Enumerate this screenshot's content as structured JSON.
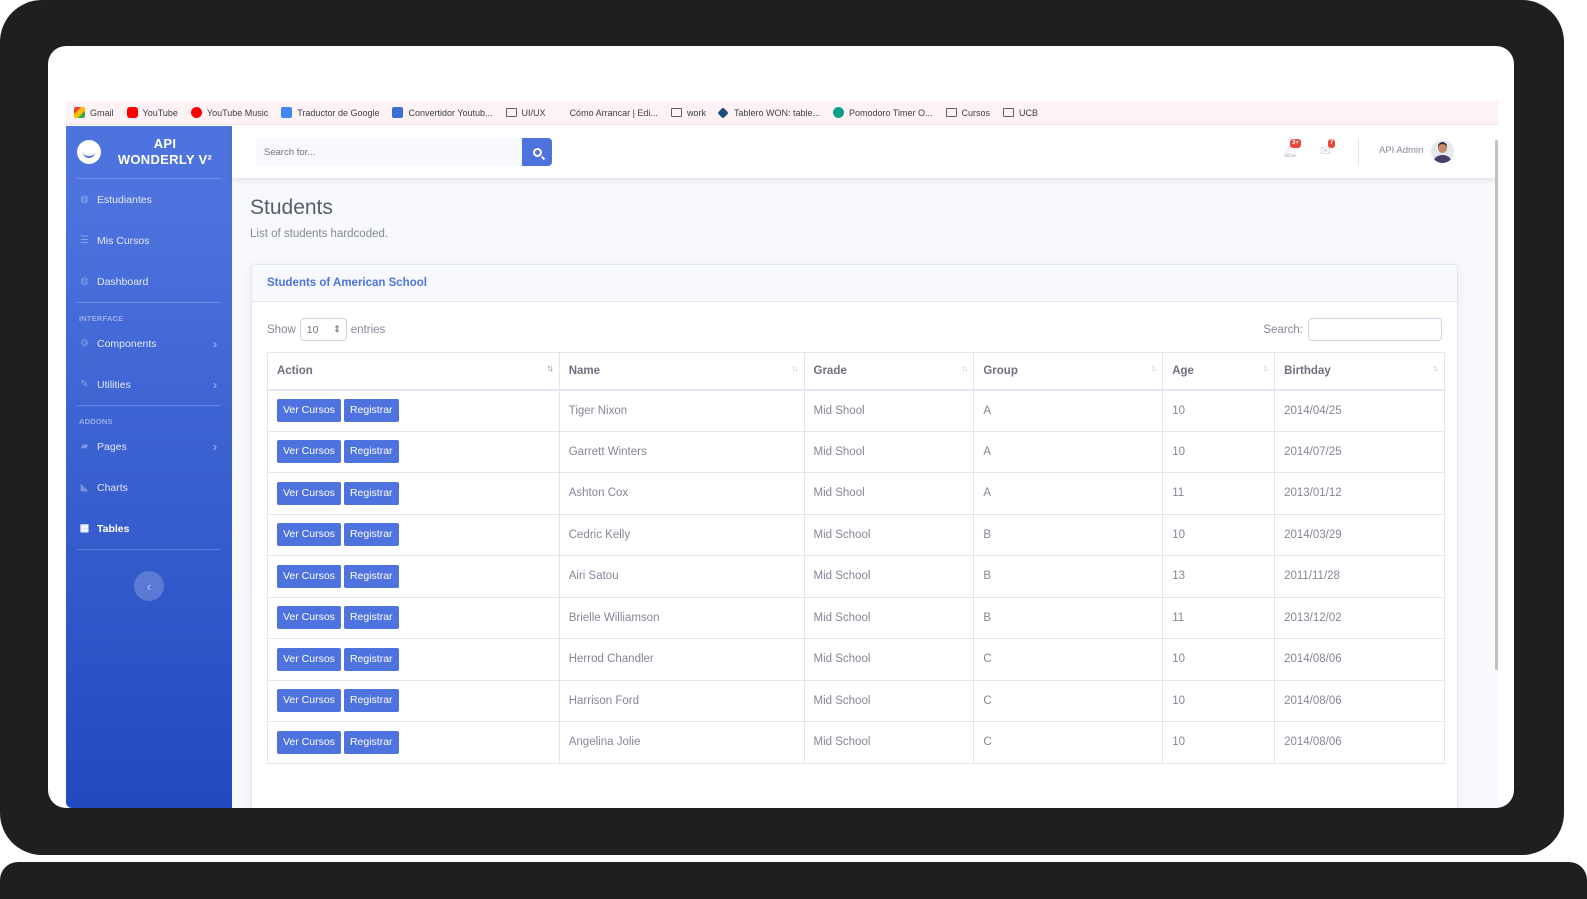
{
  "bookmarks": [
    {
      "label": "Gmail",
      "icon": "gmail-icon"
    },
    {
      "label": "YouTube",
      "icon": "youtube-icon"
    },
    {
      "label": "YouTube Music",
      "icon": "youtube-music-icon"
    },
    {
      "label": "Traductor de Google",
      "icon": "translate-icon"
    },
    {
      "label": "Convertidor Youtub...",
      "icon": "converter-icon"
    },
    {
      "label": "UI/UX",
      "icon": "folder-icon"
    },
    {
      "label": "Cómo Arrancar | Edi...",
      "icon": "page-icon"
    },
    {
      "label": "work",
      "icon": "folder-icon"
    },
    {
      "label": "Tablero WON: table...",
      "icon": "board-icon"
    },
    {
      "label": "Pomodoro Timer O...",
      "icon": "pomodoro-icon"
    },
    {
      "label": "Cursos",
      "icon": "folder-icon"
    },
    {
      "label": "UCB",
      "icon": "folder-icon"
    }
  ],
  "sidebar": {
    "brand": "API WONDERLY V²",
    "items_top": [
      {
        "label": "Estudiantes",
        "icon": "tachometer-icon"
      },
      {
        "label": "Mis Cursos",
        "icon": "list-icon"
      },
      {
        "label": "Dashboard",
        "icon": "tachometer-icon"
      }
    ],
    "heading_interface": "INTERFACE",
    "items_interface": [
      {
        "label": "Components",
        "icon": "cog-icon"
      },
      {
        "label": "Utilities",
        "icon": "wrench-icon"
      }
    ],
    "heading_addons": "ADDONS",
    "items_addons": [
      {
        "label": "Pages",
        "icon": "folder-icon"
      },
      {
        "label": "Charts",
        "icon": "chart-area-icon"
      },
      {
        "label": "Tables",
        "icon": "table-icon"
      }
    ],
    "toggle_glyph": "‹"
  },
  "topbar": {
    "search_placeholder": "Search for...",
    "alerts_badge": "3+",
    "messages_badge": "7",
    "user_name": "API Admin"
  },
  "page": {
    "title": "Students",
    "subtitle": "List of students hardcoded."
  },
  "card": {
    "title": "Students of American School",
    "show_label": "Show",
    "entries_value": "10",
    "entries_label": "entries",
    "search_label": "Search:",
    "columns": [
      "Action",
      "Name",
      "Grade",
      "Group",
      "Age",
      "Birthday"
    ],
    "action_buttons": {
      "primary": "Ver Cursos",
      "secondary": "Registrar"
    },
    "rows": [
      {
        "name": "Tiger Nixon",
        "grade": "Mid Shool",
        "group": "A",
        "age": "10",
        "birthday": "2014/04/25"
      },
      {
        "name": "Garrett Winters",
        "grade": "Mid Shool",
        "group": "A",
        "age": "10",
        "birthday": "2014/07/25"
      },
      {
        "name": "Ashton Cox",
        "grade": "Mid Shool",
        "group": "A",
        "age": "11",
        "birthday": "2013/01/12"
      },
      {
        "name": "Cedric Kelly",
        "grade": "Mid School",
        "group": "B",
        "age": "10",
        "birthday": "2014/03/29"
      },
      {
        "name": "Airi Satou",
        "grade": "Mid School",
        "group": "B",
        "age": "13",
        "birthday": "2011/11/28"
      },
      {
        "name": "Brielle Williamson",
        "grade": "Mid School",
        "group": "B",
        "age": "11",
        "birthday": "2013/12/02"
      },
      {
        "name": "Herrod Chandler",
        "grade": "Mid School",
        "group": "C",
        "age": "10",
        "birthday": "2014/08/06"
      },
      {
        "name": "Harrison Ford",
        "grade": "Mid School",
        "group": "C",
        "age": "10",
        "birthday": "2014/08/06"
      },
      {
        "name": "Angelina Jolie",
        "grade": "Mid School",
        "group": "C",
        "age": "10",
        "birthday": "2014/08/06"
      }
    ]
  },
  "colors": {
    "primary": "#4e73df",
    "sidebar_end": "#224abe",
    "badge": "#e74a3b",
    "text": "#858796"
  }
}
